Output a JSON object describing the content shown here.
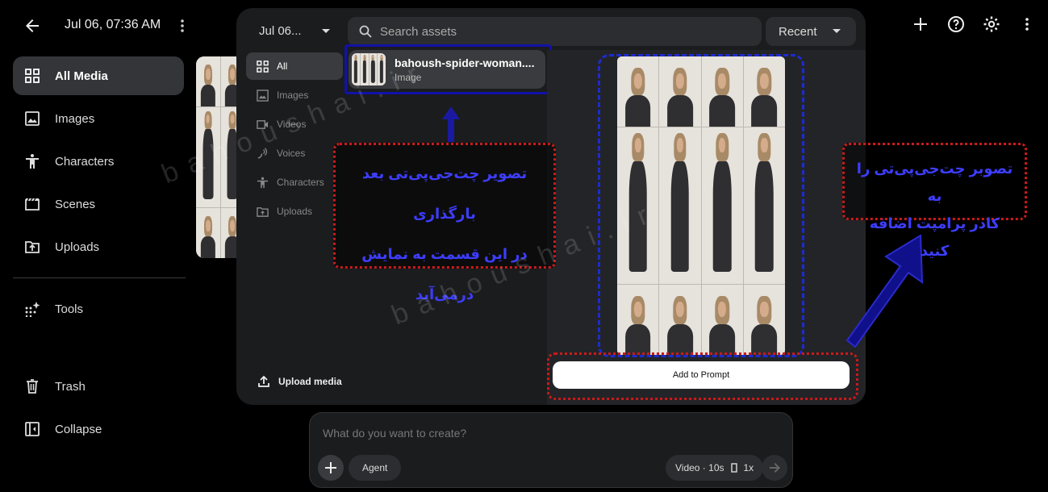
{
  "header": {
    "title": "Jul 06, 07:36 AM"
  },
  "sidebar": {
    "items": [
      {
        "label": "All Media"
      },
      {
        "label": "Images"
      },
      {
        "label": "Characters"
      },
      {
        "label": "Scenes"
      },
      {
        "label": "Uploads"
      }
    ],
    "tools_label": "Tools",
    "trash_label": "Trash",
    "collapse_label": "Collapse"
  },
  "modal": {
    "date_filter": "Jul 06...",
    "search_placeholder": "Search assets",
    "sort_label": "Recent",
    "categories": [
      {
        "label": "All"
      },
      {
        "label": "Images"
      },
      {
        "label": "Videos"
      },
      {
        "label": "Voices"
      },
      {
        "label": "Characters"
      },
      {
        "label": "Uploads"
      }
    ],
    "upload_label": "Upload media",
    "asset": {
      "name": "bahoush-spider-woman....",
      "type": "Image"
    },
    "add_button": "Add to Prompt"
  },
  "annotations": {
    "note_left": [
      "تصویر چت‌جی‌پی‌تی بعد بارگذاری",
      "در این قسمت به نمایش",
      "درمی‌آید"
    ],
    "note_right": [
      "تصوبر چت‌جی‌پی‌تی را به",
      "کادر پرامپت اضافه کنید"
    ],
    "watermark": "bahoushai.ir"
  },
  "prompt": {
    "placeholder": "What do you want to create?",
    "agent_label": "Agent",
    "video_label": "Video · 10s",
    "count_label": "1x"
  },
  "colors": {
    "background": "#000000",
    "panel": "#1b1c1e",
    "highlight_blue": "#1212a8",
    "highlight_red": "#cc1a1a",
    "note_text": "#3d3dff"
  }
}
